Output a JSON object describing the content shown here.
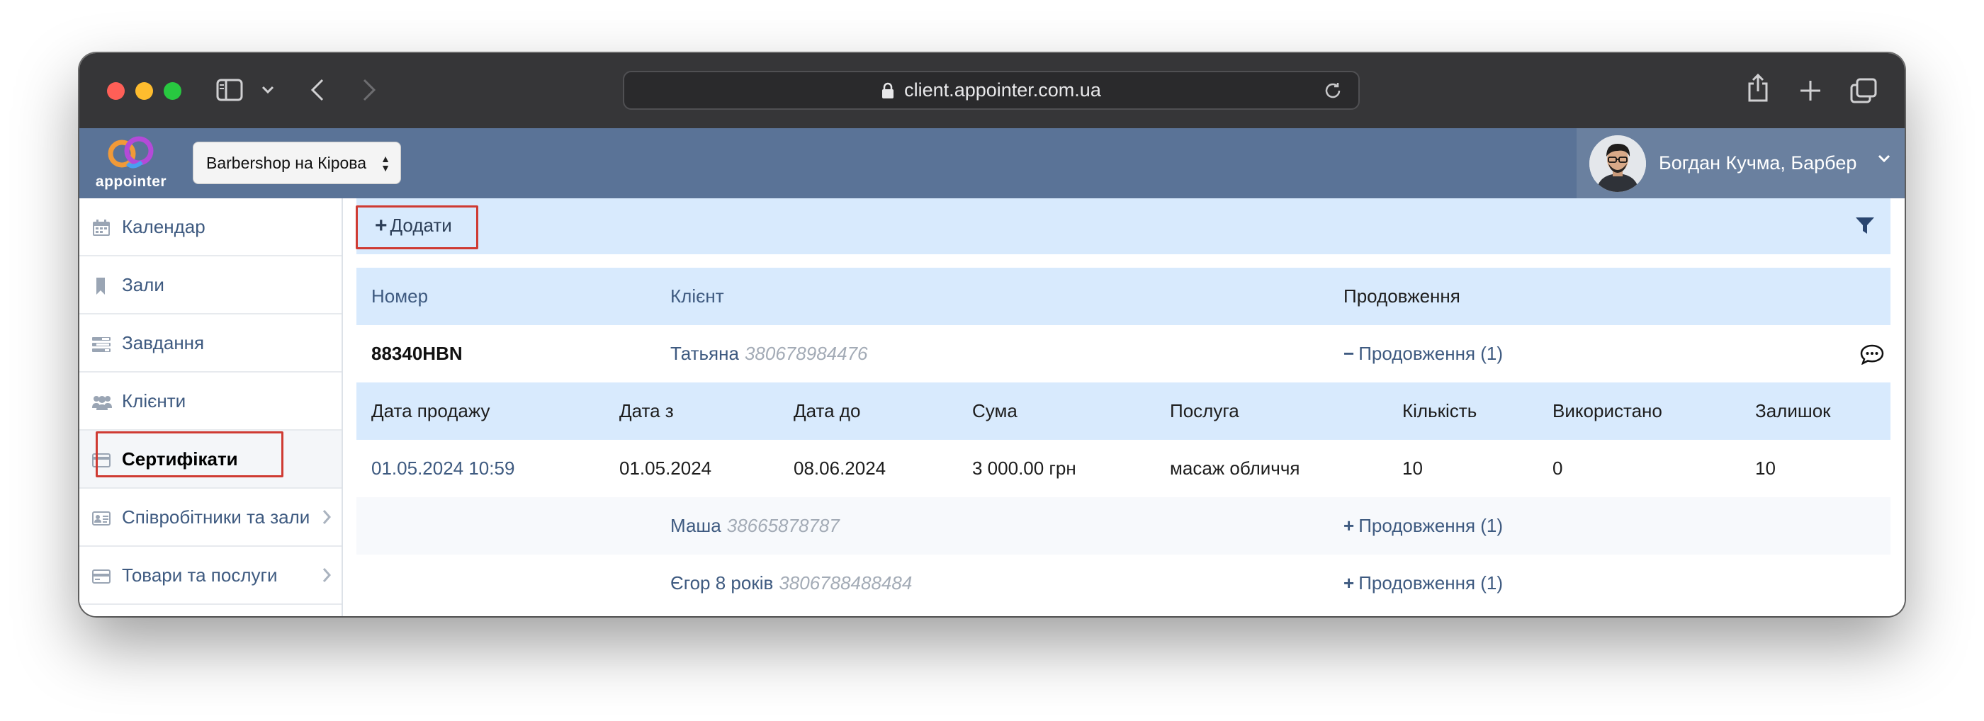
{
  "browser": {
    "url": "client.appointer.com.ua"
  },
  "header": {
    "logo_text": "appointer",
    "branch": "Barbershop на Кірова",
    "user": "Богдан Кучма, Барбер"
  },
  "sidebar": {
    "items": [
      {
        "label": "Календар",
        "icon": "calendar-icon"
      },
      {
        "label": "Зали",
        "icon": "bookmark-icon"
      },
      {
        "label": "Завдання",
        "icon": "tasks-icon"
      },
      {
        "label": "Клієнти",
        "icon": "users-icon"
      },
      {
        "label": "Сертифікати",
        "icon": "certificate-icon"
      },
      {
        "label": "Співробітники та зали",
        "icon": "id-card-icon"
      },
      {
        "label": "Товари та послуги",
        "icon": "credit-card-icon"
      }
    ]
  },
  "toolbar": {
    "add_label": "Додати"
  },
  "table": {
    "columns": [
      "Номер",
      "Клієнт",
      "Продовження"
    ],
    "rows": [
      {
        "number": "88340HBN",
        "client": "Татьяна",
        "phone": "380678984476",
        "extension": "Продовження (1)",
        "expanded": true
      },
      {
        "number": "",
        "client": "Маша",
        "phone": "38665878787",
        "extension": "Продовження (1)",
        "expanded": false
      },
      {
        "number": "",
        "client": "Єгор 8 років",
        "phone": "3806788488484",
        "extension": "Продовження (1)",
        "expanded": false
      }
    ]
  },
  "detail": {
    "columns": [
      "Дата продажу",
      "Дата з",
      "Дата до",
      "Сума",
      "Послуга",
      "Кількість",
      "Використано",
      "Залишок"
    ],
    "row": [
      "01.05.2024 10:59",
      "01.05.2024",
      "08.06.2024",
      "3 000.00 грн",
      "масаж обличчя",
      "10",
      "0",
      "10"
    ]
  },
  "colors": {
    "header_bg": "#5a7397",
    "table_head_bg": "#d8eafd",
    "link": "#3e5a80",
    "highlight": "#cf3b33"
  }
}
